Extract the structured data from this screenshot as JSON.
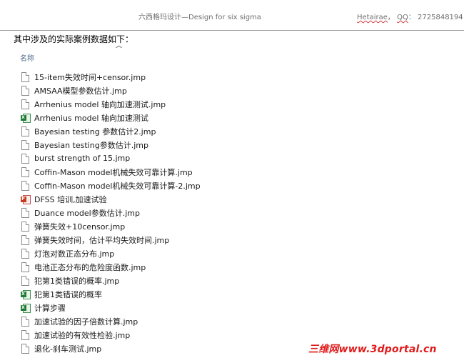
{
  "header": {
    "center_text": "六西格玛设计—Design for six sigma",
    "right_name": "Hetairae",
    "right_qq_label": "QQ",
    "right_qq_number": "2725848194"
  },
  "intro_text": "其中涉及的实际案例数据如下：",
  "column": {
    "name_label": "名称"
  },
  "files": [
    {
      "name": "15-item失效时间+censor.jmp",
      "icon": "generic-file-icon"
    },
    {
      "name": "AMSAA模型参数估计.jmp",
      "icon": "generic-file-icon"
    },
    {
      "name": "Arrhenius model 轴向加速测试.jmp",
      "icon": "generic-file-icon"
    },
    {
      "name": "Arrhenius model 轴向加速测试",
      "icon": "excel-file-icon"
    },
    {
      "name": "Bayesian testing 参数估计2.jmp",
      "icon": "generic-file-icon"
    },
    {
      "name": "Bayesian testing参数估计.jmp",
      "icon": "generic-file-icon"
    },
    {
      "name": "burst strength of 15.jmp",
      "icon": "generic-file-icon"
    },
    {
      "name": "Coffin-Mason model机械失效可靠计算.jmp",
      "icon": "generic-file-icon"
    },
    {
      "name": "Coffin-Mason model机械失效可靠计算-2.jmp",
      "icon": "generic-file-icon"
    },
    {
      "name": "DFSS 培训,加速试验",
      "icon": "powerpoint-file-icon"
    },
    {
      "name": "Duance model参数估计.jmp",
      "icon": "generic-file-icon"
    },
    {
      "name": "弹簧失效+10censor.jmp",
      "icon": "generic-file-icon"
    },
    {
      "name": "弹簧失效时间，估计平均失效时间.jmp",
      "icon": "generic-file-icon"
    },
    {
      "name": "灯泡对数正态分布.jmp",
      "icon": "generic-file-icon"
    },
    {
      "name": "电池正态分布的危险度函数.jmp",
      "icon": "generic-file-icon"
    },
    {
      "name": "犯第1类错误的概率.jmp",
      "icon": "generic-file-icon"
    },
    {
      "name": "犯第1类错误的概率",
      "icon": "excel-file-icon"
    },
    {
      "name": "计算步骤",
      "icon": "excel-file-icon"
    },
    {
      "name": "加速试验的因子倍数计算.jmp",
      "icon": "generic-file-icon"
    },
    {
      "name": "加速试验的有效性检验.jmp",
      "icon": "generic-file-icon"
    },
    {
      "name": "退化-刹车测试.jmp",
      "icon": "generic-file-icon"
    }
  ],
  "watermark": "三维网www.3dportal.cn"
}
